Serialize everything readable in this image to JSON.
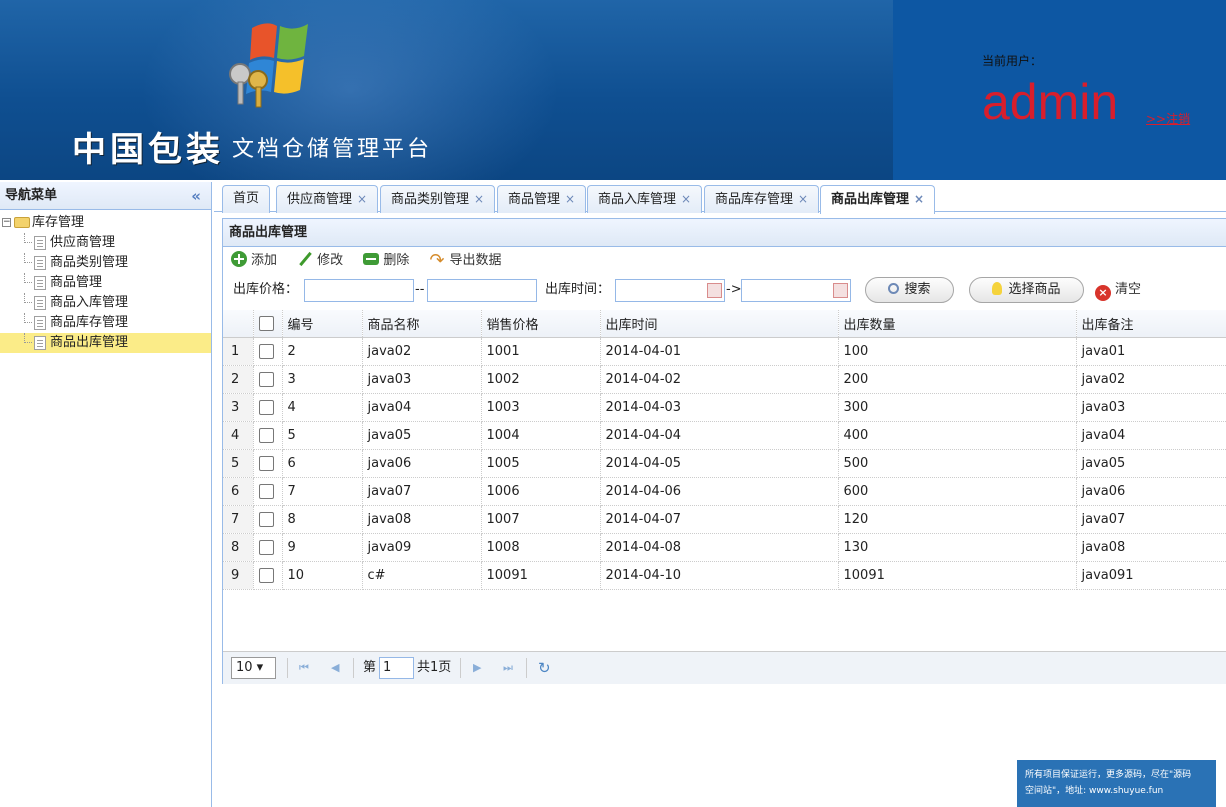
{
  "header": {
    "brand_big": "中国包装",
    "brand_small": "文档仓储管理平台",
    "user_label": "当前用户：",
    "user_name": "admin",
    "logout": ">>注销"
  },
  "nav": {
    "title": "导航菜单",
    "collapse_icon": "«",
    "root": "库存管理",
    "items": [
      "供应商管理",
      "商品类别管理",
      "商品管理",
      "商品入库管理",
      "商品库存管理",
      "商品出库管理"
    ],
    "selected": "商品出库管理"
  },
  "tabs": [
    {
      "label": "首页",
      "closable": false
    },
    {
      "label": "供应商管理",
      "closable": true
    },
    {
      "label": "商品类别管理",
      "closable": true
    },
    {
      "label": "商品管理",
      "closable": true
    },
    {
      "label": "商品入库管理",
      "closable": true
    },
    {
      "label": "商品库存管理",
      "closable": true
    },
    {
      "label": "商品出库管理",
      "closable": true,
      "active": true
    }
  ],
  "tab_close": "×",
  "panel": {
    "title": "商品出库管理",
    "toolbar": {
      "add": "添加",
      "edit": "修改",
      "delete": "删除",
      "export": "导出数据"
    },
    "filter": {
      "price_label": "出库价格：",
      "price_sep": "--",
      "time_label": "出库时间：",
      "time_sep": "->",
      "search": "搜索",
      "choose": "选择商品",
      "clear": "清空"
    }
  },
  "grid": {
    "columns": [
      "编号",
      "商品名称",
      "销售价格",
      "出库时间",
      "出库数量",
      "出库备注"
    ],
    "rows": [
      {
        "rn": "1",
        "id": "2",
        "name": "java02",
        "price": "1001",
        "time": "2014-04-01",
        "qty": "100",
        "note": "java01"
      },
      {
        "rn": "2",
        "id": "3",
        "name": "java03",
        "price": "1002",
        "time": "2014-04-02",
        "qty": "200",
        "note": "java02"
      },
      {
        "rn": "3",
        "id": "4",
        "name": "java04",
        "price": "1003",
        "time": "2014-04-03",
        "qty": "300",
        "note": "java03"
      },
      {
        "rn": "4",
        "id": "5",
        "name": "java05",
        "price": "1004",
        "time": "2014-04-04",
        "qty": "400",
        "note": "java04"
      },
      {
        "rn": "5",
        "id": "6",
        "name": "java06",
        "price": "1005",
        "time": "2014-04-05",
        "qty": "500",
        "note": "java05"
      },
      {
        "rn": "6",
        "id": "7",
        "name": "java07",
        "price": "1006",
        "time": "2014-04-06",
        "qty": "600",
        "note": "java06"
      },
      {
        "rn": "7",
        "id": "8",
        "name": "java08",
        "price": "1007",
        "time": "2014-04-07",
        "qty": "120",
        "note": "java07"
      },
      {
        "rn": "8",
        "id": "9",
        "name": "java09",
        "price": "1008",
        "time": "2014-04-08",
        "qty": "130",
        "note": "java08"
      },
      {
        "rn": "9",
        "id": "10",
        "name": "c#",
        "price": "10091",
        "time": "2014-04-10",
        "qty": "10091",
        "note": "java091"
      }
    ]
  },
  "pager": {
    "page_size": "10 ▾",
    "first": "⏮",
    "prev": "◀",
    "page_prefix": "第",
    "page_value": "1",
    "page_total": "共1页",
    "next": "▶",
    "last": "⏭",
    "refresh": "↻"
  },
  "promo": {
    "line1": "所有项目保证运行，更多源码，尽在\"源码",
    "line2": "空间站\"，地址: www.shuyue.fun"
  },
  "colors": {
    "header_bg": "#0f4f91",
    "accent_border": "#99bbe8",
    "user_name": "#d81e2c",
    "selected_row": "#fbec88"
  }
}
